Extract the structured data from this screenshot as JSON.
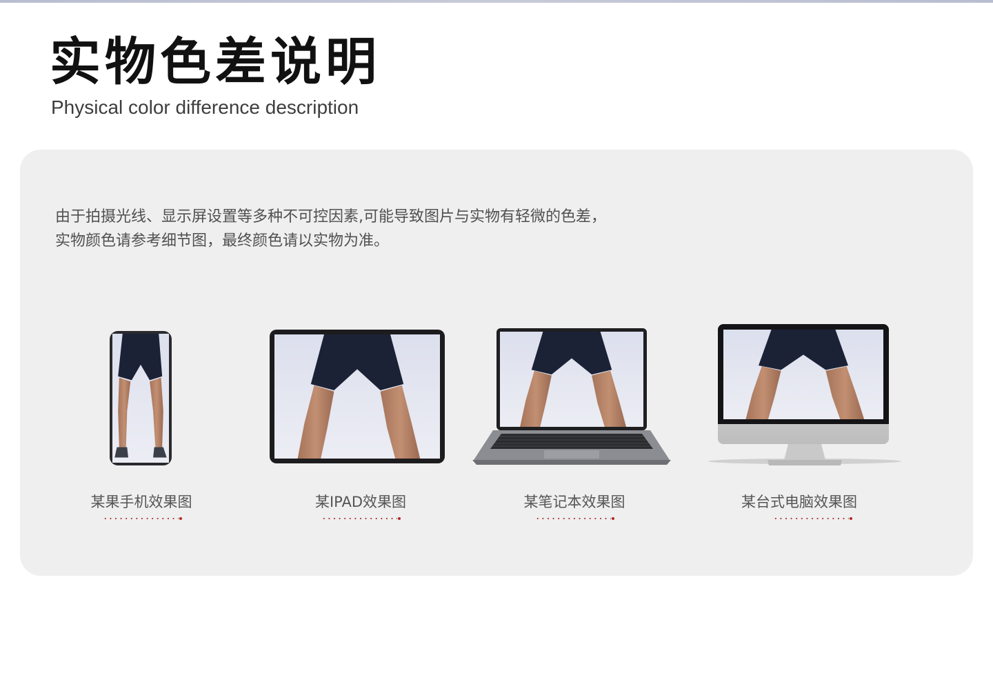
{
  "page": {
    "title_zh": "实物色差说明",
    "title_en": "Physical color difference description"
  },
  "notice": {
    "line1": "由于拍摄光线、显示屏设置等多种不可控因素,可能导致图片与实物有轻微的色差，",
    "line2": "实物颜色请参考细节图，最终颜色请以实物为准。"
  },
  "devices": [
    {
      "caption": "某果手机效果图",
      "icon": "phone-icon"
    },
    {
      "caption": "某IPAD效果图",
      "icon": "tablet-icon"
    },
    {
      "caption": "某笔记本效果图",
      "icon": "laptop-icon"
    },
    {
      "caption": "某台式电脑效果图",
      "icon": "desktop-monitor-icon"
    }
  ],
  "colors": {
    "accent_dots": "#b02828",
    "panel": "#efefef",
    "shorts": "#1b2236",
    "screen_bg": "#dfe0ec"
  }
}
